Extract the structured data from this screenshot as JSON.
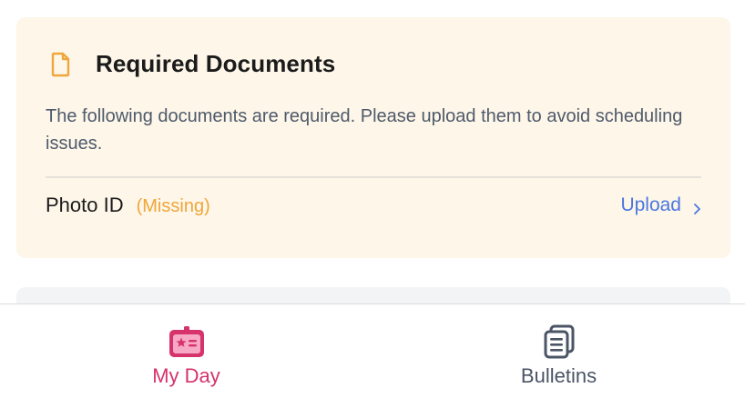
{
  "required_docs": {
    "title": "Required Documents",
    "description": "The following documents are required. Please upload them to avoid scheduling issues.",
    "items": [
      {
        "name": "Photo ID",
        "status": "(Missing)",
        "action": "Upload"
      }
    ],
    "icon": "document-icon"
  },
  "tabbar": {
    "tabs": [
      {
        "label": "My Day",
        "icon": "id-badge-icon",
        "active": true
      },
      {
        "label": "Bulletins",
        "icon": "bulletins-icon",
        "active": false
      }
    ]
  },
  "colors": {
    "card_background": "#fdf6e9",
    "accent_orange": "#f0a63a",
    "link_blue": "#4a78e0",
    "active_tab_pink": "#d6336c",
    "inactive_tab_gray": "#4b5566"
  }
}
